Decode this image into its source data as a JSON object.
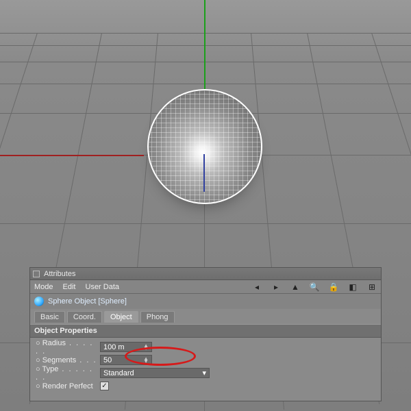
{
  "panel": {
    "title": "Attributes",
    "menus": [
      "Mode",
      "Edit",
      "User Data"
    ],
    "object_header": "Sphere Object [Sphere]",
    "tabs": [
      {
        "label": "Basic",
        "active": false
      },
      {
        "label": "Coord.",
        "active": false
      },
      {
        "label": "Object",
        "active": true
      },
      {
        "label": "Phong",
        "active": false
      }
    ],
    "section": "Object Properties",
    "props": {
      "radius_label": "Radius",
      "radius_value": "100 m",
      "segments_label": "Segments",
      "segments_value": "50",
      "type_label": "Type",
      "type_value": "Standard",
      "render_perfect_label": "Render Perfect",
      "render_perfect_checked": true
    }
  },
  "icons": {
    "prev": "◂",
    "next": "▸",
    "up": "▲",
    "search": "🔍",
    "lock": "🔒",
    "new": "◧",
    "add": "⊞"
  }
}
